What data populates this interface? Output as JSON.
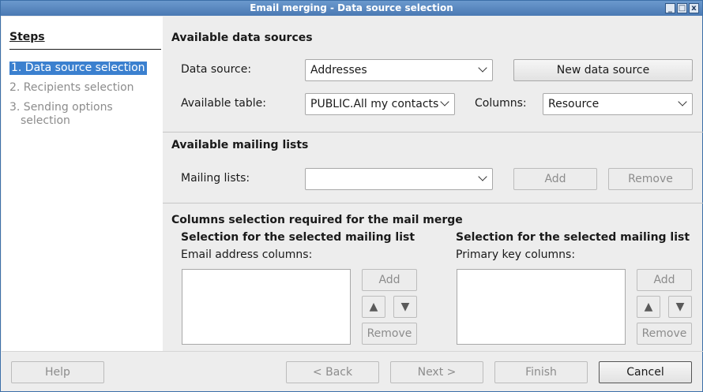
{
  "window": {
    "title": "Email merging - Data source selection",
    "controls": [
      "_",
      "□",
      "x"
    ]
  },
  "sidebar": {
    "title": "Steps",
    "steps": [
      {
        "label": "1. Data source selection",
        "active": true
      },
      {
        "label": "2. Recipients selection",
        "active": false
      },
      {
        "label": "3. Sending options",
        "active": false
      },
      {
        "label": "selection",
        "active": false
      }
    ]
  },
  "data_sources": {
    "title": "Available data sources",
    "data_source_label": "Data source:",
    "data_source_value": "Addresses",
    "new_data_source_label": "New data source",
    "table_label": "Available table:",
    "table_value": "PUBLIC.All my contacts",
    "columns_label": "Columns:",
    "columns_value": "Resource"
  },
  "mailing": {
    "title": "Available mailing lists",
    "lists_label": "Mailing lists:",
    "lists_value": "",
    "add_label": "Add",
    "remove_label": "Remove"
  },
  "columns_selection": {
    "title": "Columns selection required for the mail merge",
    "left": {
      "subtitle": "Selection for the selected mailing list",
      "label": "Email address columns:",
      "add_label": "Add",
      "remove_label": "Remove",
      "up": "▲",
      "down": "▼"
    },
    "right": {
      "subtitle": "Selection for the selected mailing list",
      "label": "Primary key columns:",
      "add_label": "Add",
      "remove_label": "Remove",
      "up": "▲",
      "down": "▼"
    }
  },
  "footer": {
    "help": "Help",
    "back": "< Back",
    "next": "Next >",
    "finish": "Finish",
    "cancel": "Cancel"
  }
}
